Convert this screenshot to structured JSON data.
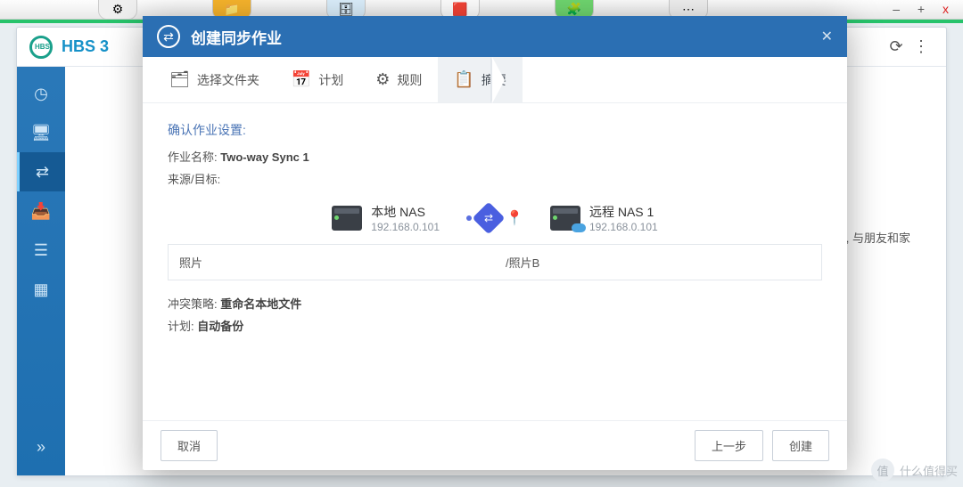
{
  "os": {
    "min": "–",
    "max": "+",
    "close": "x"
  },
  "app": {
    "title": "HBS 3"
  },
  "sidebar": {
    "collapse": "»"
  },
  "bg": {
    "msg_fragment": "作 , 与朋友和家"
  },
  "modal": {
    "title": "创建同步作业",
    "steps": {
      "folder": "选择文件夹",
      "schedule": "计划",
      "rules": "规则",
      "summary": "摘要"
    },
    "section": "确认作业设置:",
    "jobname_label": "作业名称:",
    "jobname_value": "Two-way Sync 1",
    "srcdst_label": "来源/目标:",
    "local": {
      "name": "本地 NAS",
      "ip": "192.168.0.101"
    },
    "remote": {
      "name": "远程 NAS 1",
      "ip": "192.168.0.101"
    },
    "table": {
      "src": "照片",
      "dst": "/照片B"
    },
    "conflict_label": "冲突策略:",
    "conflict_value": "重命名本地文件",
    "sched_label": "计划:",
    "sched_value": "自动备份",
    "buttons": {
      "cancel": "取消",
      "prev": "上一步",
      "create": "创建"
    }
  },
  "watermark": "什么值得买"
}
